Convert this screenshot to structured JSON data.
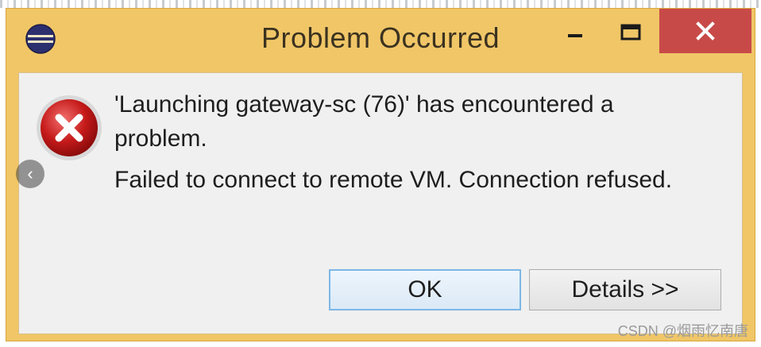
{
  "window": {
    "title": "Problem Occurred",
    "colors": {
      "frame": "#f0c667",
      "close": "#c84a48",
      "client": "#f0f0f0"
    }
  },
  "titlebar": {
    "app_icon": "eclipse-icon",
    "minimize_icon": "minimize-icon",
    "maximize_icon": "maximize-icon",
    "close_icon": "close-icon"
  },
  "dialog": {
    "icon": "error-icon",
    "message": "'Launching gateway-sc (76)' has encountered a problem.",
    "detail": "Failed to connect to remote VM. Connection refused."
  },
  "buttons": {
    "ok_label": "OK",
    "details_label": "Details >>"
  },
  "overlay": {
    "nav_label": "‹",
    "watermark": "CSDN @烟雨忆南唐"
  }
}
